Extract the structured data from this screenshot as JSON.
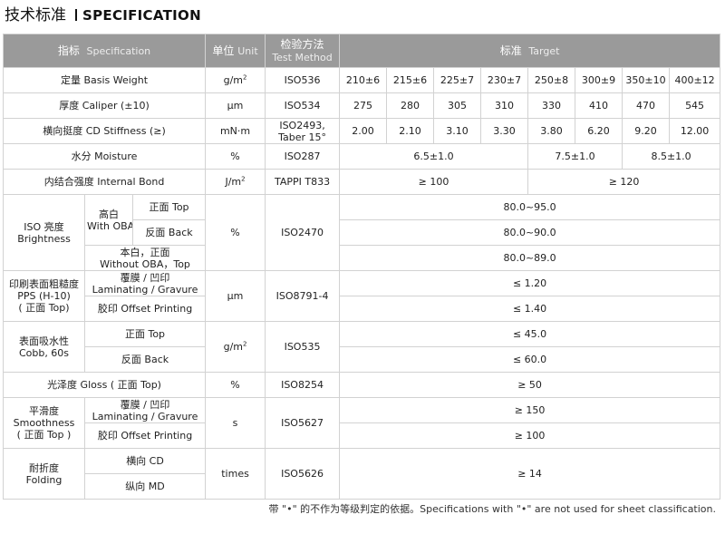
{
  "title": {
    "zh": "技术标准",
    "en": "SPECIFICATION"
  },
  "header": {
    "spec_zh": "指标",
    "spec_en": "Specification",
    "unit_zh": "单位",
    "unit_en": "Unit",
    "method_zh": "检验方法",
    "method_en": "Test Method",
    "target_zh": "标准",
    "target_en": "Target"
  },
  "rows": {
    "basis_weight": {
      "label": "定量 Basis Weight",
      "unit": "g/m",
      "unit_sup": "2",
      "method": "ISO536",
      "values": [
        "210±6",
        "215±6",
        "225±7",
        "230±7",
        "250±8",
        "300±9",
        "350±10",
        "400±12"
      ]
    },
    "caliper": {
      "label": "厚度 Caliper (±10)",
      "unit": "μm",
      "method": "ISO534",
      "values": [
        "275",
        "280",
        "305",
        "310",
        "330",
        "410",
        "470",
        "545"
      ]
    },
    "stiffness": {
      "label": "横向挺度 CD Stiffness (≥)",
      "unit": "mN·m",
      "method_line1": "ISO2493,",
      "method_line2": "Taber 15°",
      "values": [
        "2.00",
        "2.10",
        "3.10",
        "3.30",
        "3.80",
        "6.20",
        "9.20",
        "12.00"
      ]
    },
    "moisture": {
      "label": "水分 Moisture",
      "unit": "%",
      "method": "ISO287",
      "values": [
        "6.5±1.0",
        "7.5±1.0",
        "8.5±1.0"
      ]
    },
    "internal_bond": {
      "label": "内结合强度 Internal Bond",
      "unit": "J/m",
      "unit_sup": "2",
      "method": "TAPPI T833",
      "values": [
        "≥ 100",
        "≥ 120"
      ]
    },
    "brightness": {
      "label_line1": "ISO 亮度",
      "label_line2": "Brightness",
      "oba_line1": "高白",
      "oba_line2": "With OBA",
      "top": "正面 Top",
      "back": "反面 Back",
      "no_oba_line1": "本白，正面",
      "no_oba_line2": "Without OBA，Top",
      "unit": "%",
      "method": "ISO2470",
      "values": [
        "80.0~95.0",
        "80.0~90.0",
        "80.0~89.0"
      ]
    },
    "pps": {
      "label_line1": "印刷表面粗糙度",
      "label_line2": "PPS (H-10)",
      "label_line3": "( 正面 Top)",
      "laminating_line1": "覆膜 / 凹印",
      "laminating_line2": "Laminating / Gravure",
      "offset": "胶印  Offset Printing",
      "unit": "μm",
      "method": "ISO8791-4",
      "values": [
        "≤ 1.20",
        "≤ 1.40"
      ]
    },
    "cobb": {
      "label_line1": "表面吸水性",
      "label_line2": "Cobb, 60s",
      "top": "正面 Top",
      "back": "反面 Back",
      "unit": "g/m",
      "unit_sup": "2",
      "method": "ISO535",
      "values": [
        "≤ 45.0",
        "≤ 60.0"
      ]
    },
    "gloss": {
      "label": "光泽度 Gloss ( 正面 Top)",
      "unit": "%",
      "method": "ISO8254",
      "value": "≥ 50"
    },
    "smoothness": {
      "label_line1": "平滑度",
      "label_line2": "Smoothness",
      "label_line3": "( 正面 Top )",
      "laminating_line1": "覆膜 / 凹印",
      "laminating_line2": "Laminating / Gravure",
      "offset": "胶印  Offset Printing",
      "unit": "s",
      "method": "ISO5627",
      "values": [
        "≥ 150",
        "≥ 100"
      ]
    },
    "folding": {
      "label_line1": "耐折度",
      "label_line2": "Folding",
      "cd": "横向 CD",
      "md": "纵向 MD",
      "unit": "times",
      "method": "ISO5626",
      "value": "≥ 14"
    }
  },
  "note": "带 \"•\" 的不作为等级判定的依据。Specifications with \"•\" are not used for sheet classification."
}
